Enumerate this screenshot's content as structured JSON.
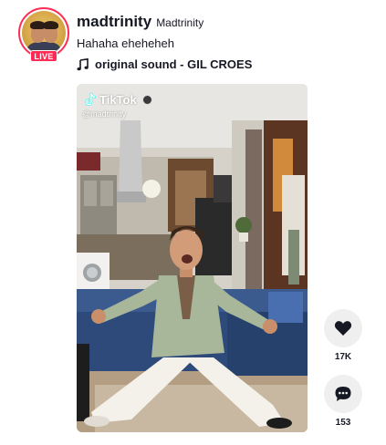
{
  "post": {
    "author": {
      "username": "madtrinity",
      "nickname": "Madtrinity",
      "live_badge": "LIVE",
      "avatar_icon": "avatar-image"
    },
    "caption": "Hahaha eheheheh",
    "music": {
      "icon": "music-note-icon",
      "title": "original sound - GIL CROES"
    },
    "video": {
      "watermark_brand": "TikTok",
      "watermark_handle": "@madtrinity"
    },
    "actions": {
      "like": {
        "icon": "heart-icon",
        "count": "17K"
      },
      "comment": {
        "icon": "comment-icon",
        "count": "153"
      }
    }
  },
  "colors": {
    "accent": "#fe2c55",
    "text": "#161823",
    "action_bg": "#efefef"
  }
}
